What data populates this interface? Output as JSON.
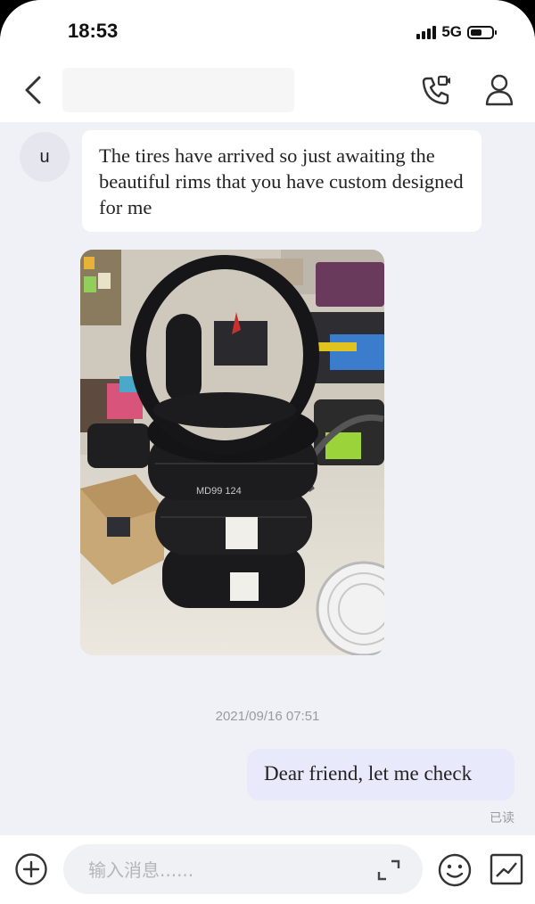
{
  "status_bar": {
    "time": "18:53",
    "network": "5G"
  },
  "header": {
    "back_icon": "chevron-left-icon",
    "call_icon": "video-call-icon",
    "profile_icon": "person-icon"
  },
  "messages": [
    {
      "type": "text",
      "direction": "incoming",
      "avatar_letter": "u",
      "text": "The tires have arrived so just awaiting the beautiful rims that you have custom designed for me"
    },
    {
      "type": "image",
      "direction": "incoming",
      "photo_text": "MD99 124"
    },
    {
      "type": "timestamp",
      "text": "2021/09/16 07:51"
    },
    {
      "type": "text",
      "direction": "outgoing",
      "text": "Dear friend, let me check",
      "status": "已读"
    }
  ],
  "composer": {
    "placeholder": "输入消息......",
    "value": ""
  },
  "colors": {
    "chat_bg": "#f0f1f6",
    "incoming_bubble": "#ffffff",
    "outgoing_bubble": "#e8eafc"
  }
}
